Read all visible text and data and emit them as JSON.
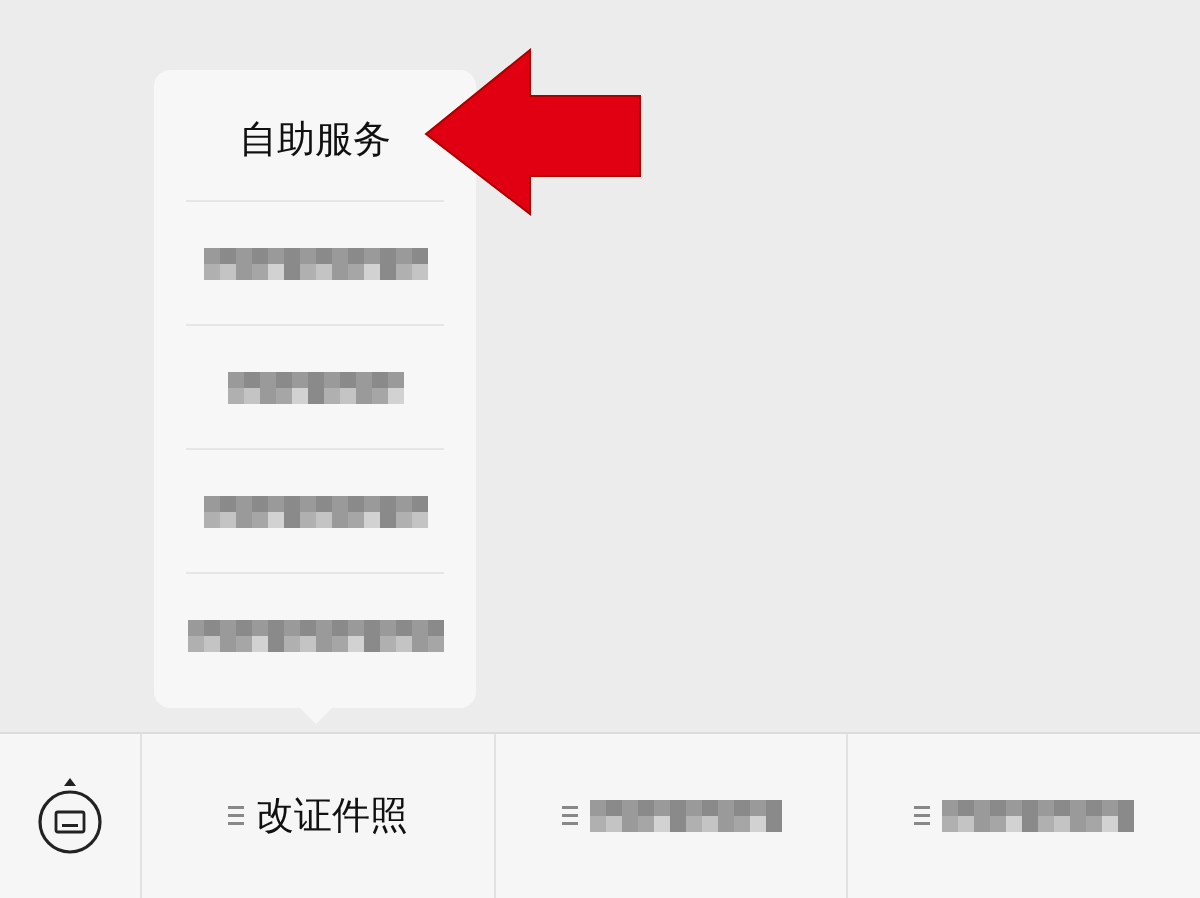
{
  "popup_menu": {
    "items": [
      {
        "kind": "label",
        "text": "自助服务"
      },
      {
        "kind": "blurred"
      },
      {
        "kind": "blurred"
      },
      {
        "kind": "blurred"
      },
      {
        "kind": "blurred"
      }
    ]
  },
  "bottom_menu": {
    "tabs": [
      {
        "kind": "label",
        "text": "改证件照"
      },
      {
        "kind": "blurred"
      },
      {
        "kind": "blurred"
      }
    ]
  }
}
